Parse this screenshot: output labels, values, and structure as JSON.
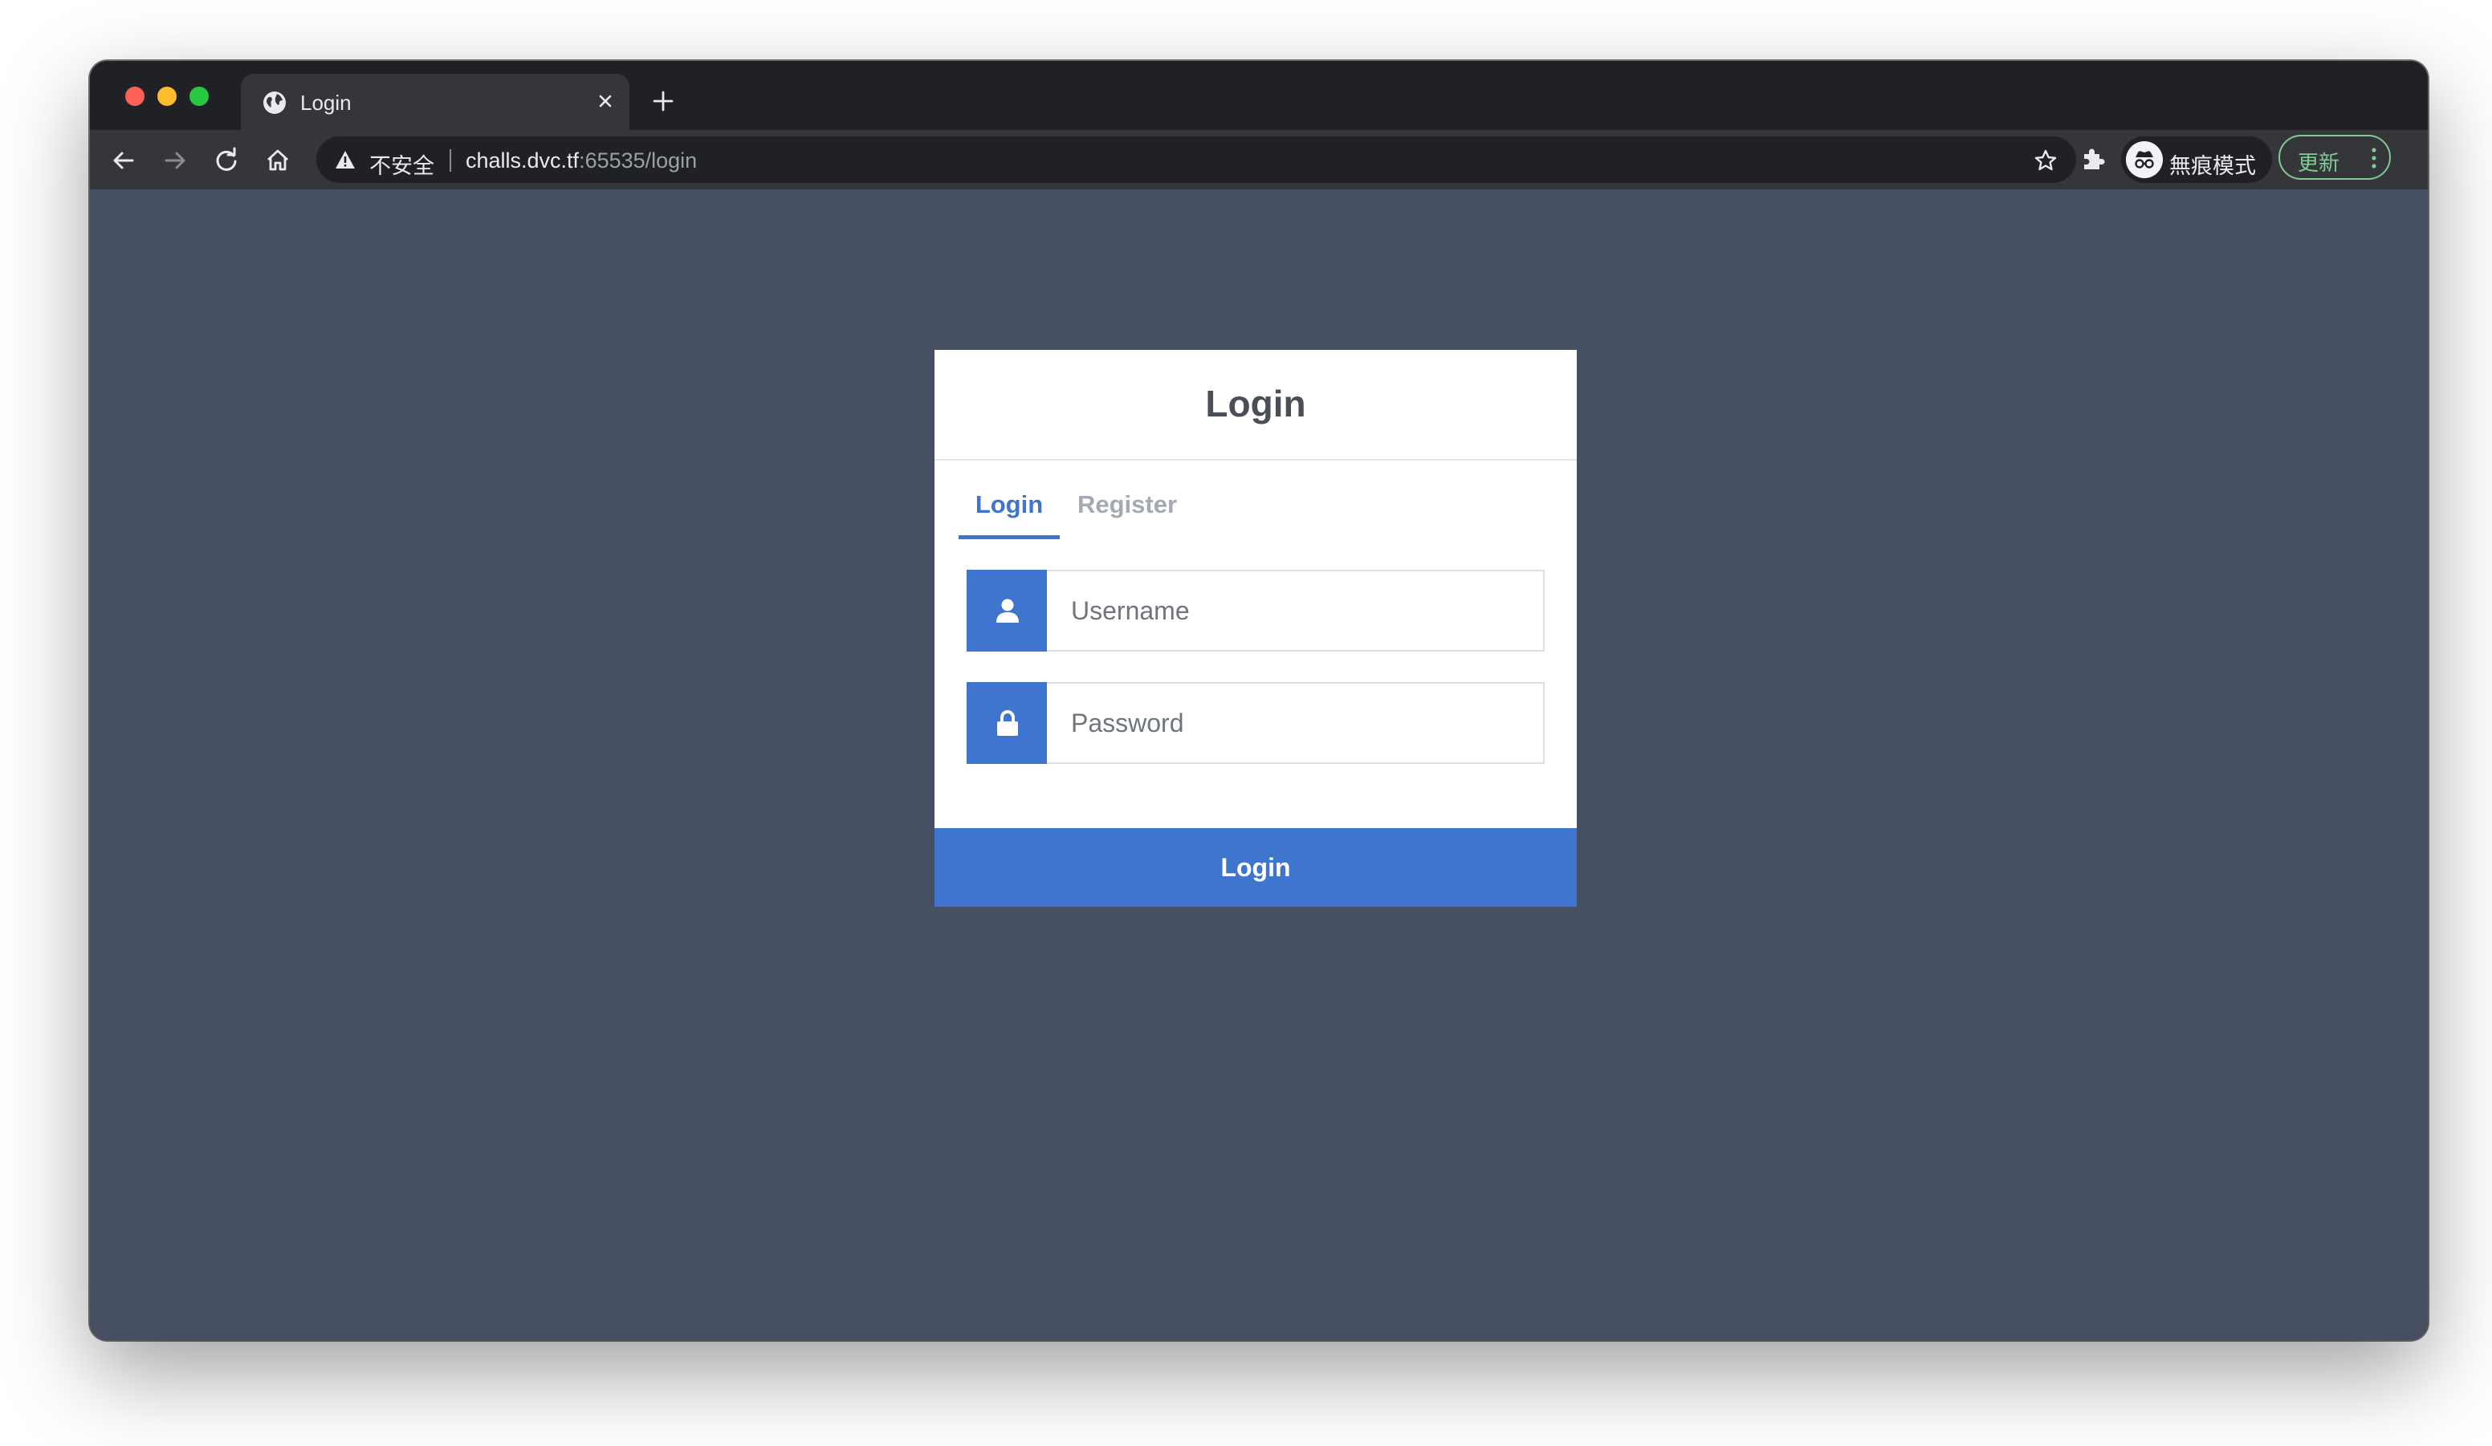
{
  "browser": {
    "tab_title": "Login",
    "security_label": "不安全",
    "url_host": "challs.dvc.tf",
    "url_rest": ":65535/login",
    "profile_label": "無痕模式",
    "update_label": "更新",
    "icons": [
      "close-icon",
      "new-tab-icon",
      "back-icon",
      "forward-icon",
      "reload-icon",
      "home-icon",
      "warning-icon",
      "star-icon",
      "extensions-icon",
      "incognito-icon",
      "more-icon"
    ]
  },
  "login_form": {
    "heading": "Login",
    "tabs": [
      {
        "label": "Login",
        "active": true
      },
      {
        "label": "Register",
        "active": false
      }
    ],
    "username": {
      "placeholder": "Username",
      "value": ""
    },
    "password": {
      "placeholder": "Password",
      "value": ""
    },
    "submit_label": "Login"
  },
  "colors": {
    "page_background": "#475063",
    "accent": "#3f74cf",
    "browser_frame": "#202124",
    "toolbar": "#35363a",
    "update_green": "#81c995"
  }
}
